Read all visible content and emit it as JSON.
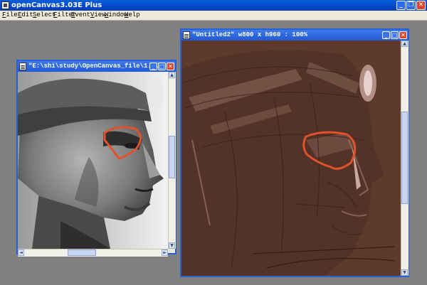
{
  "app": {
    "title": "openCanvas3.03E Plus",
    "caption_buttons": {
      "minimize": "_",
      "restore": "❐",
      "close": "✕"
    }
  },
  "menu": {
    "items": [
      "File",
      "Edit",
      "Select",
      "Filter",
      "Event",
      "View",
      "Window",
      "Help"
    ]
  },
  "reference_window": {
    "title": "\"E:\\shi\\study\\OpenCanvas_file\\1...",
    "buttons": {
      "minimize": "_",
      "maximize": "□",
      "close": "✕"
    },
    "scroll_arrows": {
      "up": "▲",
      "down": "▼",
      "left": "◄",
      "right": "►"
    }
  },
  "canvas_window": {
    "title": "\"Untitled2\" w800 x h960 : 100%",
    "buttons": {
      "minimize": "_",
      "maximize": "□",
      "close": "✕"
    },
    "scroll_arrows": {
      "up": "▲",
      "down": "▼"
    }
  },
  "colors": {
    "desktop": "#808080",
    "titlebar_active": "#0047c8",
    "canvas_brown": "#5e3a2d",
    "annotation_red": "#e0512d"
  }
}
